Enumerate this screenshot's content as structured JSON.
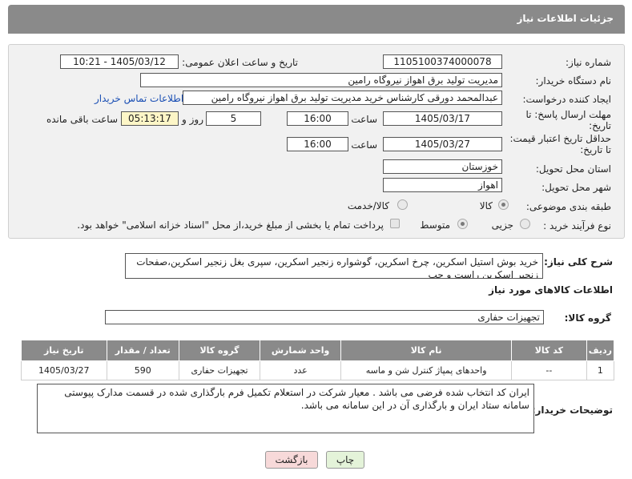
{
  "header": {
    "title": "جزئیات اطلاعات نیاز"
  },
  "form": {
    "need_number_label": "شماره نیاز:",
    "need_number": "1105100374000078",
    "announce_label": "تاریخ و ساعت اعلان عمومی:",
    "announce_value": "1405/03/12 - 10:21",
    "buyer_org_label": "نام دستگاه خریدار:",
    "buyer_org": "مدیریت تولید برق اهواز نیروگاه رامین",
    "creator_label": "ایجاد کننده درخواست:",
    "creator": "عبدالمحمد دورقی کارشناس خرید مدیریت تولید برق اهواز نیروگاه رامین",
    "contact_link": "اطلاعات تماس خریدار",
    "reply_deadline_label": "مهلت ارسال پاسخ: تا تاریخ:",
    "reply_date": "1405/03/17",
    "time_label": "ساعت",
    "reply_time": "16:00",
    "days_value": "5",
    "days_label": "روز و",
    "remaining_time": "05:13:17",
    "remaining_label": "ساعت باقی مانده",
    "price_validity_label": "حداقل تاریخ اعتبار قیمت: تا تاریخ:",
    "price_date": "1405/03/27",
    "price_time": "16:00",
    "province_label": "استان محل تحویل:",
    "province": "خوزستان",
    "city_label": "شهر محل تحویل:",
    "city": "اهواز",
    "category_label": "طبقه بندی موضوعی:",
    "category_options": [
      "کالا",
      "کالا/خدمت"
    ],
    "process_label": "نوع فرآیند خرید :",
    "process_options": [
      "جزیی",
      "متوسط"
    ],
    "payment_note": "پرداخت تمام یا بخشی از مبلغ خرید،از محل \"اسناد خزانه اسلامی\" خواهد بود."
  },
  "summary": {
    "label": "شرح کلی نیاز:",
    "text": "خرید بوش استیل اسکرین، چرخ اسکرین، گوشواره زنجیر اسکرین، سپری بغل زنجیر اسکرین،صفحات زنجیر اسکرین راست و چپ"
  },
  "goods": {
    "section_title": "اطلاعات کالاهای مورد نیاز",
    "group_label": "گروه کالا:",
    "group_value": "تجهیزات حفاری"
  },
  "table": {
    "headers": [
      "ردیف",
      "کد کالا",
      "نام کالا",
      "واحد شمارش",
      "گروه کالا",
      "تعداد / مقدار",
      "تاریخ نیاز"
    ],
    "rows": [
      [
        "1",
        "--",
        "واحدهای پمپاژ کنترل شن و ماسه",
        "عدد",
        "تجهیزات حفاری",
        "590",
        "1405/03/27"
      ]
    ]
  },
  "buyer_notes": {
    "label": "توضیحات خریدار:",
    "text": "ایران کد انتخاب شده فرضی می باشد . معیار شرکت در استعلام تکمیل فرم بارگذاری شده در قسمت مدارک پیوستی سامانه ستاد ایران و بارگذاری آن در این سامانه می باشد."
  },
  "buttons": {
    "print": "چاپ",
    "back": "بازگشت"
  },
  "colors": {
    "header_bg": "#8a8a8a",
    "back_button_bg": "#f7d9d9",
    "print_button_bg": "#e4f3d9",
    "link": "#1a4fb4"
  }
}
